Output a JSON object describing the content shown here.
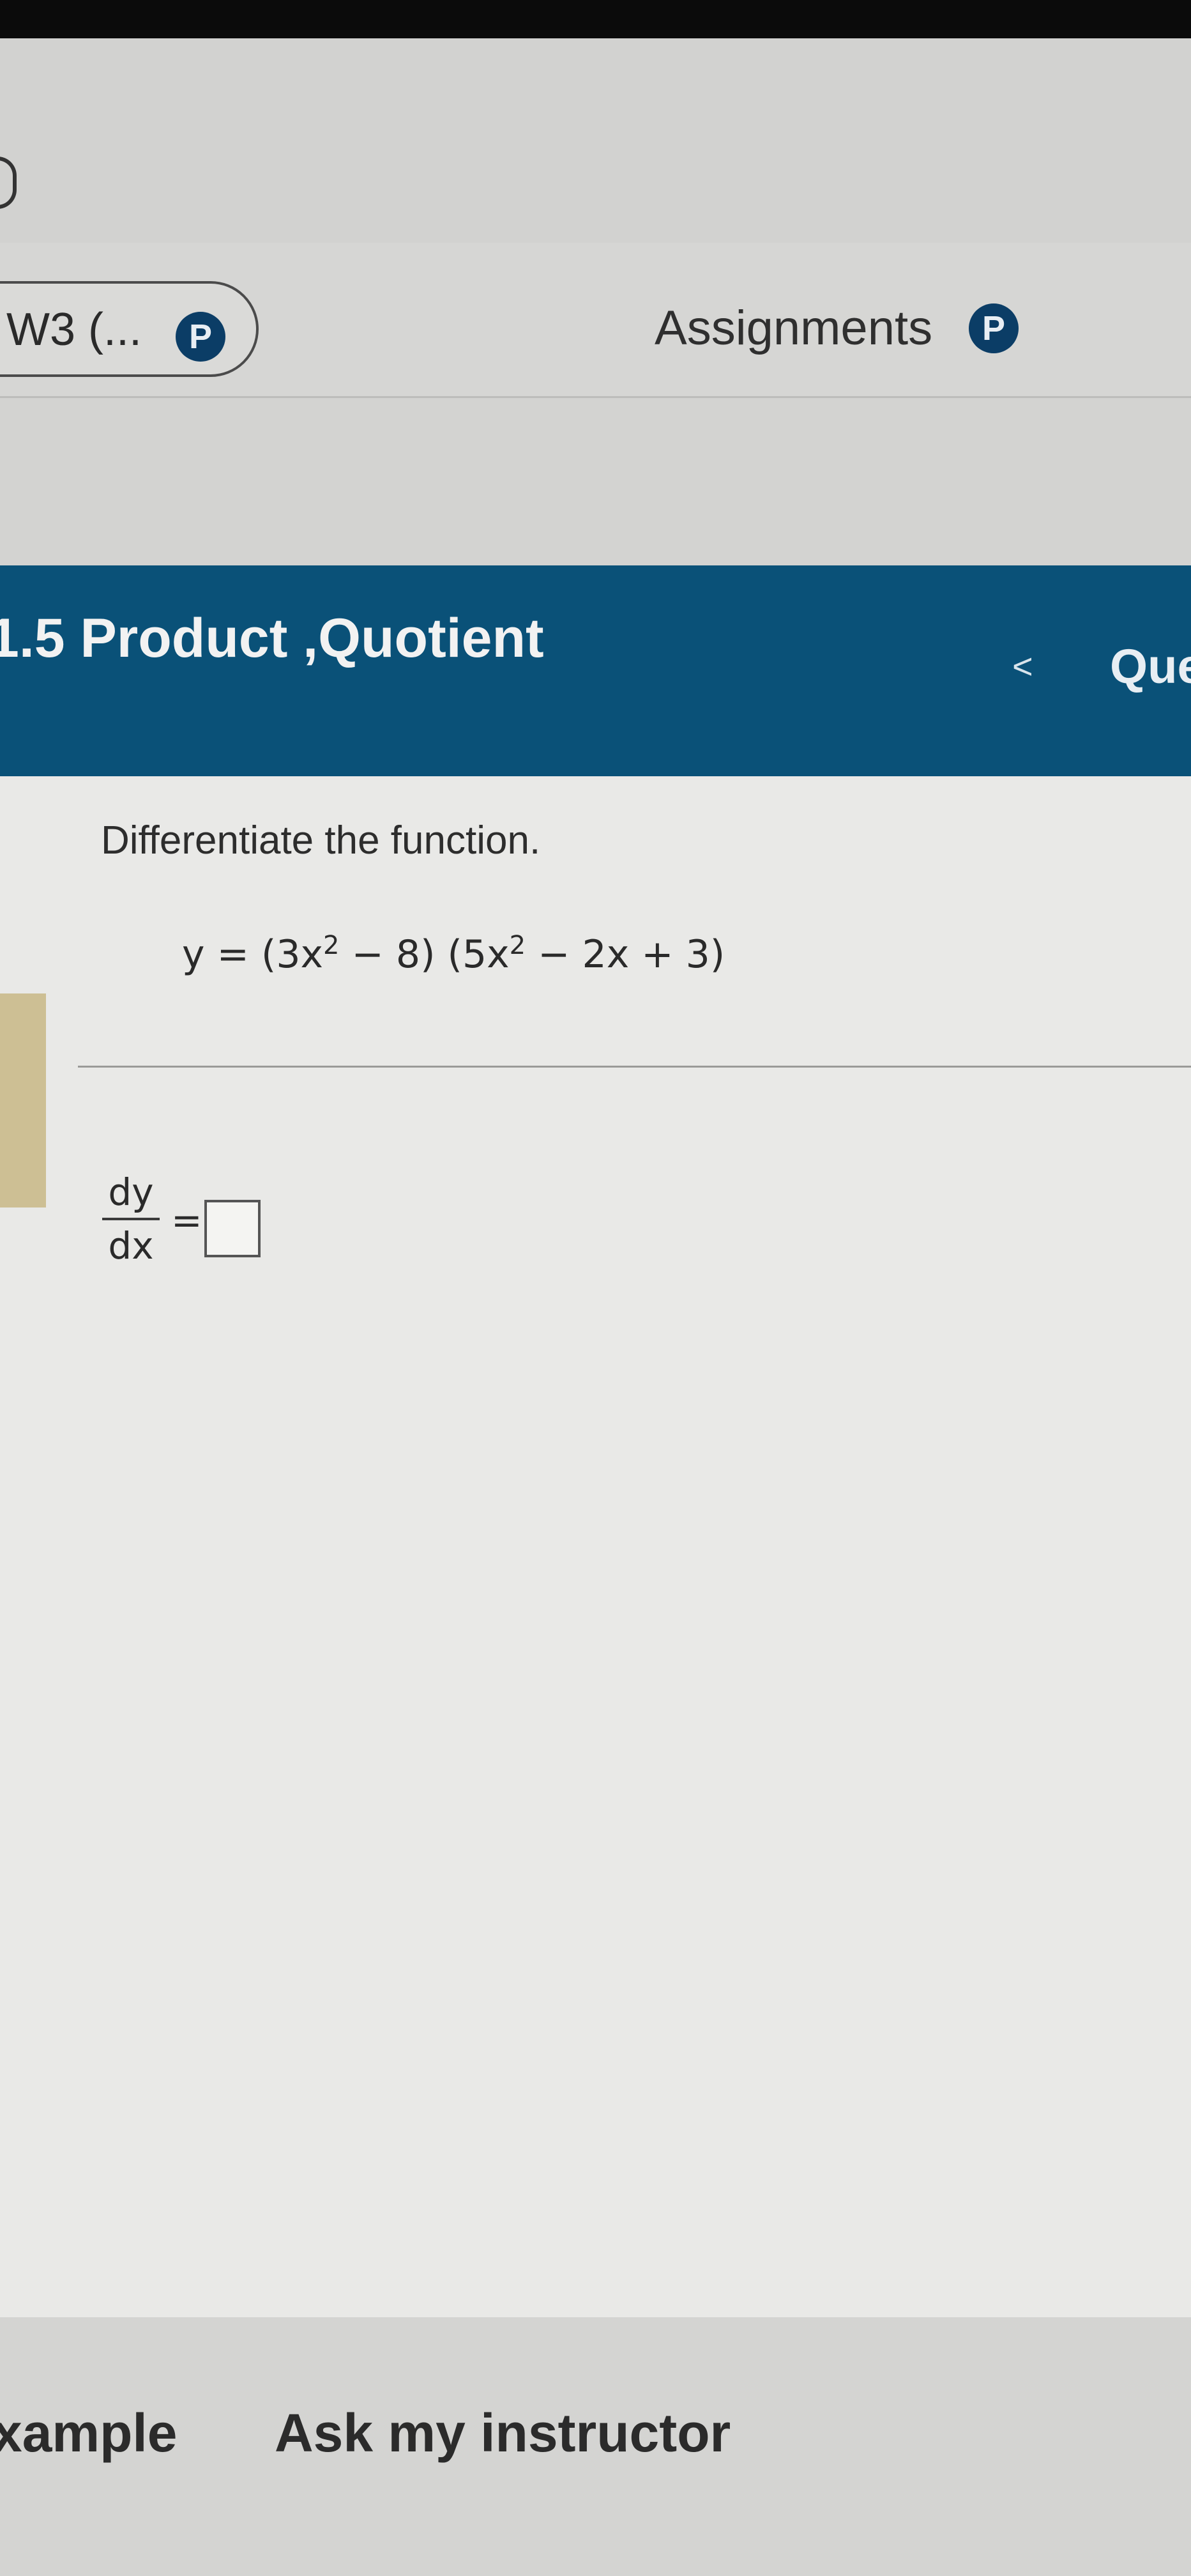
{
  "nav": {
    "course_label": "W3 (...",
    "course_icon": "P",
    "assignments_label": "Assignments",
    "assignments_icon": "P"
  },
  "header": {
    "section_title": "1.5 Product ,Quotient",
    "prev_arrow": "<",
    "question_label": "Que"
  },
  "problem": {
    "instruction": "Differentiate the function.",
    "equation": {
      "lhs": "y = ",
      "f1_coeff": "(3x",
      "f1_exp": "2",
      "f1_rest": " − 8)",
      "f2_coeff": " (5x",
      "f2_exp": "2",
      "f2_rest": " − 2x + 3)"
    },
    "answer": {
      "numerator": "dy",
      "denominator": "dx",
      "equals": "=",
      "value": ""
    }
  },
  "footer": {
    "example_label": "xample",
    "ask_label": "Ask my instructor"
  },
  "colors": {
    "header_bg": "#0a5178",
    "pearson_icon": "#0b3d66",
    "content_bg": "#e9e9e7"
  }
}
